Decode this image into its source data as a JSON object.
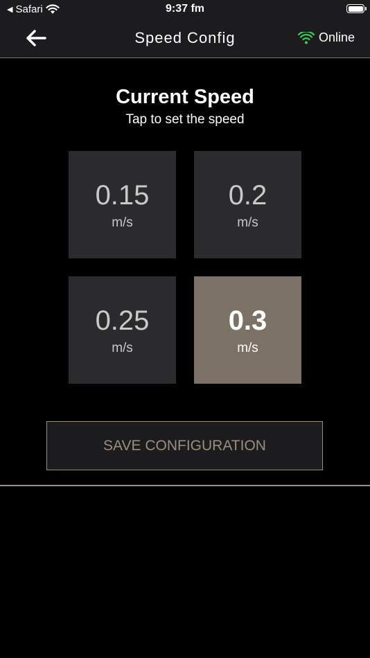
{
  "status_bar": {
    "back_app": "Safari",
    "time": "9:37 fm"
  },
  "nav": {
    "title": "Speed Config",
    "connection_status": "Online",
    "connection_color": "#3ecf5a"
  },
  "main": {
    "heading": "Current Speed",
    "subheading": "Tap to set the speed",
    "speeds": [
      {
        "value": "0.15",
        "unit": "m/s",
        "selected": false
      },
      {
        "value": "0.2",
        "unit": "m/s",
        "selected": false
      },
      {
        "value": "0.25",
        "unit": "m/s",
        "selected": false
      },
      {
        "value": "0.3",
        "unit": "m/s",
        "selected": true
      }
    ],
    "save_label": "SAVE CONFIGURATION"
  },
  "colors": {
    "accent": "#7b7164",
    "tile_bg": "#2b2b2d",
    "bar_bg": "#1c1c1e"
  }
}
